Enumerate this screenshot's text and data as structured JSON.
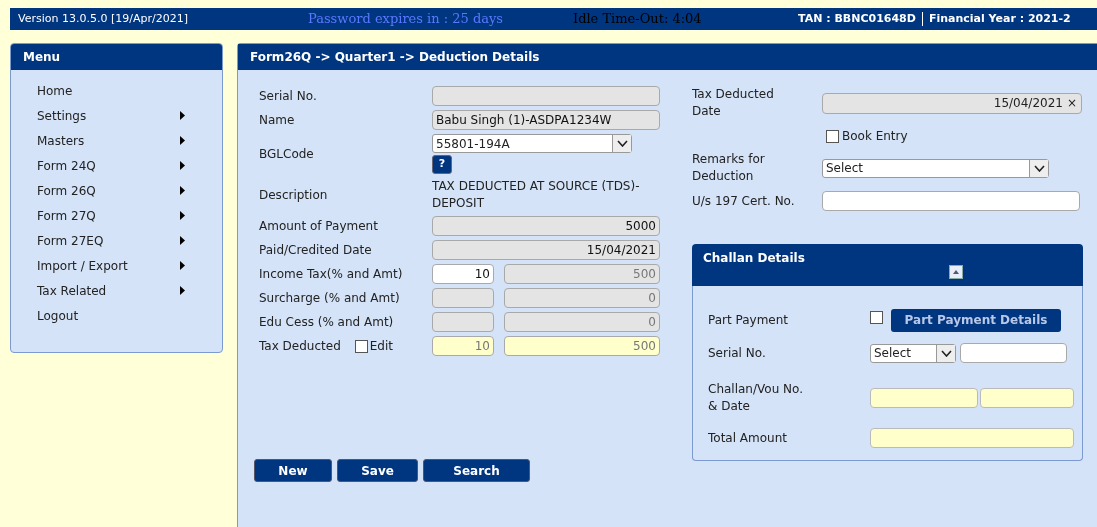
{
  "header": {
    "version": "Version 13.0.5.0 [19/Apr/2021]",
    "password_notice": "Password expires in : 25 days",
    "idle_timeout": "Idle Time-Out: 4:04",
    "tan": "TAN : BBNC01648D",
    "financial_year": "Financial Year : 2021-2"
  },
  "menu": {
    "title": "Menu",
    "items": [
      {
        "label": "Home",
        "has_submenu": false
      },
      {
        "label": "Settings",
        "has_submenu": true
      },
      {
        "label": "Masters",
        "has_submenu": true
      },
      {
        "label": "Form 24Q",
        "has_submenu": true
      },
      {
        "label": "Form 26Q",
        "has_submenu": true
      },
      {
        "label": "Form 27Q",
        "has_submenu": true
      },
      {
        "label": "Form 27EQ",
        "has_submenu": true
      },
      {
        "label": "Import / Export",
        "has_submenu": true
      },
      {
        "label": "Tax Related",
        "has_submenu": true
      },
      {
        "label": "Logout",
        "has_submenu": false
      }
    ]
  },
  "form": {
    "title": "Form26Q -> Quarter1 -> Deduction Details",
    "left_fields": [
      {
        "kind": "input",
        "label": "Serial No.",
        "inputs": [
          {
            "disabled": true
          }
        ]
      },
      {
        "kind": "input",
        "label": "Name",
        "inputs": [
          {
            "disabled": true,
            "right_aligned": false,
            "value": "Babu Singh (1)-ASDPA1234W"
          }
        ]
      },
      {
        "kind": "select",
        "label": "BGLCode",
        "value": "55801-194A",
        "help": "?"
      },
      {
        "kind": "text",
        "label": "Description",
        "value": "TAX DEDUCTED AT SOURCE (TDS)-DEPOSIT"
      },
      {
        "kind": "input",
        "label": "Amount of Payment",
        "inputs": [
          {
            "disabled": true,
            "right_aligned": true,
            "value": "5000"
          }
        ]
      },
      {
        "kind": "input",
        "label": "Paid/Credited Date",
        "inputs": [
          {
            "disabled": true,
            "right_aligned": true,
            "value": "15/04/2021"
          }
        ]
      },
      {
        "kind": "pair",
        "label": "Income Tax(% and Amt)",
        "inputs": [
          {
            "disabled": false,
            "value": "10"
          },
          {
            "disabled": true,
            "highlighted": false,
            "value": "500"
          }
        ]
      },
      {
        "kind": "pair",
        "label": "Surcharge (% and Amt)",
        "inputs": [
          {
            "disabled": true
          },
          {
            "disabled": true,
            "highlighted": false,
            "value": "0"
          }
        ]
      },
      {
        "kind": "pair",
        "label": "Edu Cess (% and Amt)",
        "inputs": [
          {
            "disabled": true
          },
          {
            "disabled": true,
            "highlighted": false,
            "value": "0"
          }
        ]
      },
      {
        "kind": "pair",
        "label": "Tax Deducted",
        "check": {
          "label": "Edit",
          "checked": false
        },
        "inputs": [
          {
            "highlighted": true,
            "value": "10"
          },
          {
            "highlighted": true,
            "value": "500"
          }
        ]
      }
    ],
    "right_fields": [
      {
        "kind": "date",
        "label": "Tax Deducted Date",
        "value": "15/04/2021",
        "clear": "×"
      },
      {
        "kind": "checkbox",
        "label": "Book Entry",
        "checked": false
      },
      {
        "kind": "select",
        "label": "Remarks for Deduction",
        "value": "Select"
      },
      {
        "kind": "input",
        "label": "U/s 197 Cert. No.",
        "inputs": [
          {
            "disabled": false
          }
        ]
      }
    ],
    "challan": {
      "title": "Challan Details",
      "expanded": true,
      "part_payment": {
        "label": "Part Payment",
        "checked": false,
        "button": "Part Payment Details"
      },
      "serial": {
        "label": "Serial No.",
        "value": "Select"
      },
      "challan_no": {
        "label": "Challan/Vou No. & Date"
      },
      "total": {
        "label": "Total Amount"
      }
    },
    "buttons": [
      "New",
      "Save",
      "Search"
    ]
  }
}
